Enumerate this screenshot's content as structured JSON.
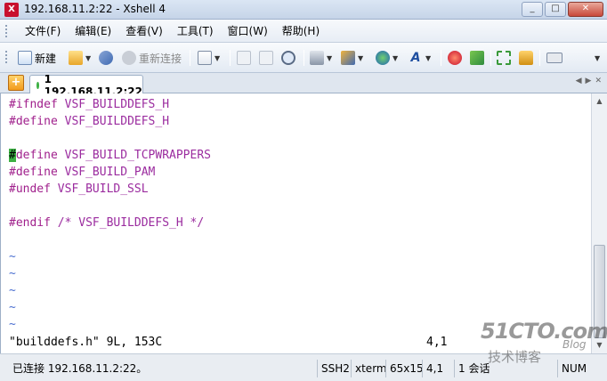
{
  "window": {
    "title": "192.168.11.2:22 - Xshell 4",
    "controls": [
      "minimize",
      "maximize",
      "close"
    ]
  },
  "menu": {
    "items": [
      "文件(F)",
      "编辑(E)",
      "查看(V)",
      "工具(T)",
      "窗口(W)",
      "帮助(H)"
    ]
  },
  "toolbar": {
    "new_label": "新建",
    "reconnect_label": "重新连接"
  },
  "tabs": [
    {
      "label": "1 192.168.11.2:22",
      "active": true,
      "status_color": "#3cb043"
    }
  ],
  "terminal": {
    "lines": [
      {
        "kw": "#ifndef",
        "text": " VSF_BUILDDEFS_H"
      },
      {
        "kw": "#define",
        "text": " VSF_BUILDDEFS_H"
      },
      {
        "kw": "",
        "text": ""
      },
      {
        "cursor": "#",
        "kw": "define",
        "text": " VSF_BUILD_TCPWRAPPERS"
      },
      {
        "kw": "#define",
        "text": " VSF_BUILD_PAM"
      },
      {
        "kw": "#undef",
        "text": " VSF_BUILD_SSL"
      },
      {
        "kw": "",
        "text": ""
      },
      {
        "kw": "#endif",
        "text": " /* VSF_BUILDDEFS_H */"
      },
      {
        "kw": "",
        "text": ""
      },
      {
        "tilde": "~"
      },
      {
        "tilde": "~"
      },
      {
        "tilde": "~"
      },
      {
        "tilde": "~"
      },
      {
        "tilde": "~"
      }
    ],
    "status_line": "\"builddefs.h\" 9L, 153C",
    "cursor_position": "4,1"
  },
  "statusbar": {
    "connection": "已连接 192.168.11.2:22。",
    "protocol": "SSH2",
    "term_type": "xterm",
    "size": "65x15",
    "position": "4,1",
    "sessions": "1 会话",
    "num": "NUM"
  },
  "watermark": {
    "brand": "51CTO.com",
    "subtitle": "技术博客",
    "blog": "Blog"
  },
  "colors": {
    "keyword": "#a0208c",
    "text": "#9b2c9f",
    "tilde": "#4a6fd0",
    "cursor": "#3cb043"
  }
}
